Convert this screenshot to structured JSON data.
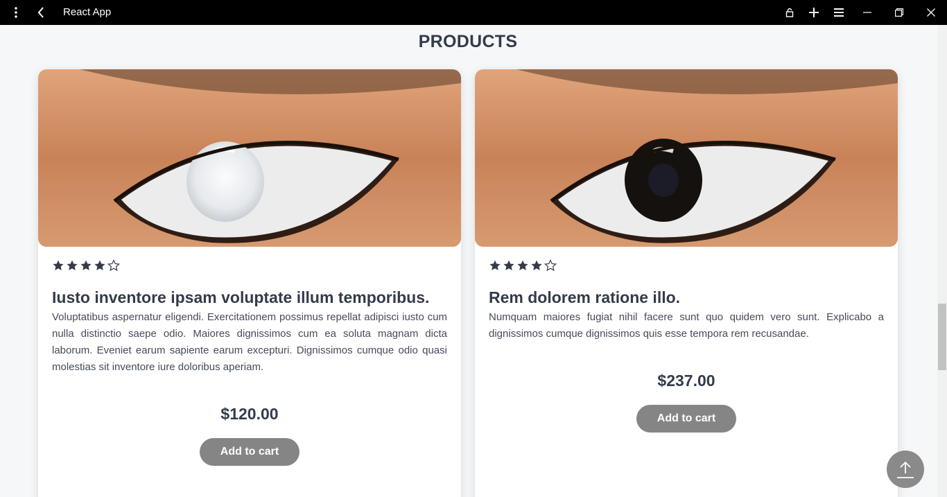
{
  "window": {
    "title": "React App",
    "icons": [
      "more-vertical-icon",
      "back-icon",
      "lock-icon",
      "plus-icon",
      "menu-icon",
      "minimize-icon",
      "restore-icon",
      "close-icon"
    ]
  },
  "page": {
    "section_title": "PRODUCTS"
  },
  "products": [
    {
      "rating": 4,
      "max_rating": 5,
      "name": "Iusto inventore ipsam voluptate illum temporibus.",
      "description": "Voluptatibus aspernatur eligendi. Exercitationem possimus repellat adipisci iusto cum nulla distinctio saepe odio. Maiores dignissimos cum ea soluta magnam dicta laborum. Eveniet earum sapiente earum excepturi. Dignissimos cumque odio quasi molestias sit inventore iure doloribus aperiam.",
      "price": "$120.00",
      "button_label": "Add to cart",
      "lens_color": "#e9ecef"
    },
    {
      "rating": 4,
      "max_rating": 5,
      "name": "Rem dolorem ratione illo.",
      "description": "Numquam maiores fugiat nihil facere sunt quo quidem vero sunt. Explicabo a dignissimos cumque dignissimos quis esse tempora rem recusandae.",
      "price": "$237.00",
      "button_label": "Add to cart",
      "lens_color": "#15110f"
    }
  ],
  "colors": {
    "accent_text": "#333b4b",
    "button": "#858585",
    "titlebar": "#000000"
  }
}
